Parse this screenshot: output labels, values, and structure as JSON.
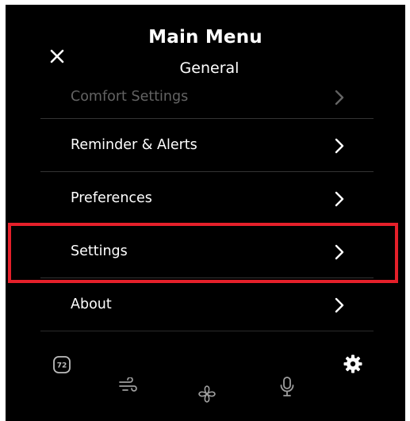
{
  "header": {
    "title": "Main Menu",
    "subtitle": "General"
  },
  "menu": {
    "items": [
      {
        "label": "Comfort Settings"
      },
      {
        "label": "Reminder & Alerts"
      },
      {
        "label": "Preferences"
      },
      {
        "label": "Settings"
      },
      {
        "label": "About"
      }
    ],
    "highlighted_item": "Settings"
  },
  "bottom_nav": {
    "thermostat_value": "72",
    "icons": [
      "thermostat-icon",
      "air-flow-icon",
      "fan-icon",
      "microphone-icon",
      "gear-icon"
    ]
  },
  "colors": {
    "background": "#000000",
    "text": "#ffffff",
    "highlight": "#e5202a",
    "divider": "#333333"
  }
}
